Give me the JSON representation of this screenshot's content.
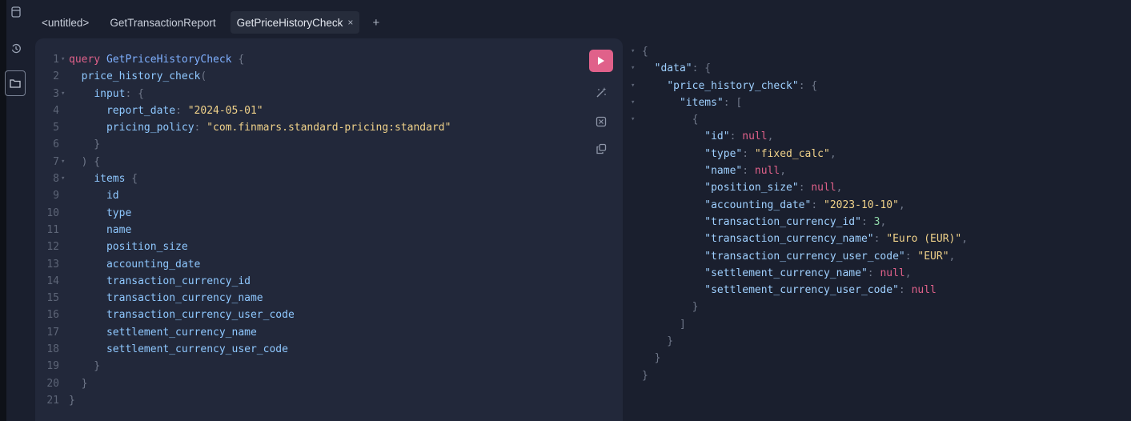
{
  "tabs": [
    {
      "label": "<untitled>"
    },
    {
      "label": "GetTransactionReport"
    },
    {
      "label": "GetPriceHistoryCheck",
      "close": "×"
    }
  ],
  "tab_add": "+",
  "query": {
    "keyword": "query",
    "name": "GetPriceHistoryCheck",
    "lines": [
      {
        "n": "1",
        "fold": "▾"
      },
      {
        "n": "2",
        "fold": ""
      },
      {
        "n": "3",
        "fold": "▾"
      },
      {
        "n": "4",
        "fold": ""
      },
      {
        "n": "5",
        "fold": ""
      },
      {
        "n": "6",
        "fold": ""
      },
      {
        "n": "7",
        "fold": "▾"
      },
      {
        "n": "8",
        "fold": "▾"
      },
      {
        "n": "9",
        "fold": ""
      },
      {
        "n": "10",
        "fold": ""
      },
      {
        "n": "11",
        "fold": ""
      },
      {
        "n": "12",
        "fold": ""
      },
      {
        "n": "13",
        "fold": ""
      },
      {
        "n": "14",
        "fold": ""
      },
      {
        "n": "15",
        "fold": ""
      },
      {
        "n": "16",
        "fold": ""
      },
      {
        "n": "17",
        "fold": ""
      },
      {
        "n": "18",
        "fold": ""
      },
      {
        "n": "19",
        "fold": ""
      },
      {
        "n": "20",
        "fold": ""
      },
      {
        "n": "21",
        "fold": ""
      }
    ],
    "field": "price_history_check",
    "input_key": "input",
    "args": [
      {
        "key": "report_date",
        "value": "\"2024-05-01\""
      },
      {
        "key": "pricing_policy",
        "value": "\"com.finmars.standard-pricing:standard\""
      }
    ],
    "items_key": "items",
    "fields": [
      "id",
      "type",
      "name",
      "position_size",
      "accounting_date",
      "transaction_currency_id",
      "transaction_currency_name",
      "transaction_currency_user_code",
      "settlement_currency_name",
      "settlement_currency_user_code"
    ]
  },
  "result": {
    "data_key": "\"data\"",
    "field_key": "\"price_history_check\"",
    "items_key": "\"items\"",
    "entries": [
      {
        "key": "\"id\"",
        "value": "null",
        "kind": "null",
        "comma": ","
      },
      {
        "key": "\"type\"",
        "value": "\"fixed_calc\"",
        "kind": "str",
        "comma": ","
      },
      {
        "key": "\"name\"",
        "value": "null",
        "kind": "null",
        "comma": ","
      },
      {
        "key": "\"position_size\"",
        "value": "null",
        "kind": "null",
        "comma": ","
      },
      {
        "key": "\"accounting_date\"",
        "value": "\"2023-10-10\"",
        "kind": "str",
        "comma": ","
      },
      {
        "key": "\"transaction_currency_id\"",
        "value": "3",
        "kind": "num",
        "comma": ","
      },
      {
        "key": "\"transaction_currency_name\"",
        "value": "\"Euro (EUR)\"",
        "kind": "str",
        "comma": ","
      },
      {
        "key": "\"transaction_currency_user_code\"",
        "value": "\"EUR\"",
        "kind": "str",
        "comma": ","
      },
      {
        "key": "\"settlement_currency_name\"",
        "value": "null",
        "kind": "null",
        "comma": ","
      },
      {
        "key": "\"settlement_currency_user_code\"",
        "value": "null",
        "kind": "null",
        "comma": ""
      }
    ]
  },
  "icons": {
    "run": "play-icon",
    "prettify": "magic-wand-icon",
    "merge": "merge-icon",
    "copy": "copy-icon",
    "rail": [
      "document-icon",
      "history-icon",
      "folder-icon"
    ]
  },
  "colors": {
    "accent": "#e0618a",
    "editor_bg": "#22283a",
    "page_bg": "#1a1f2e"
  }
}
